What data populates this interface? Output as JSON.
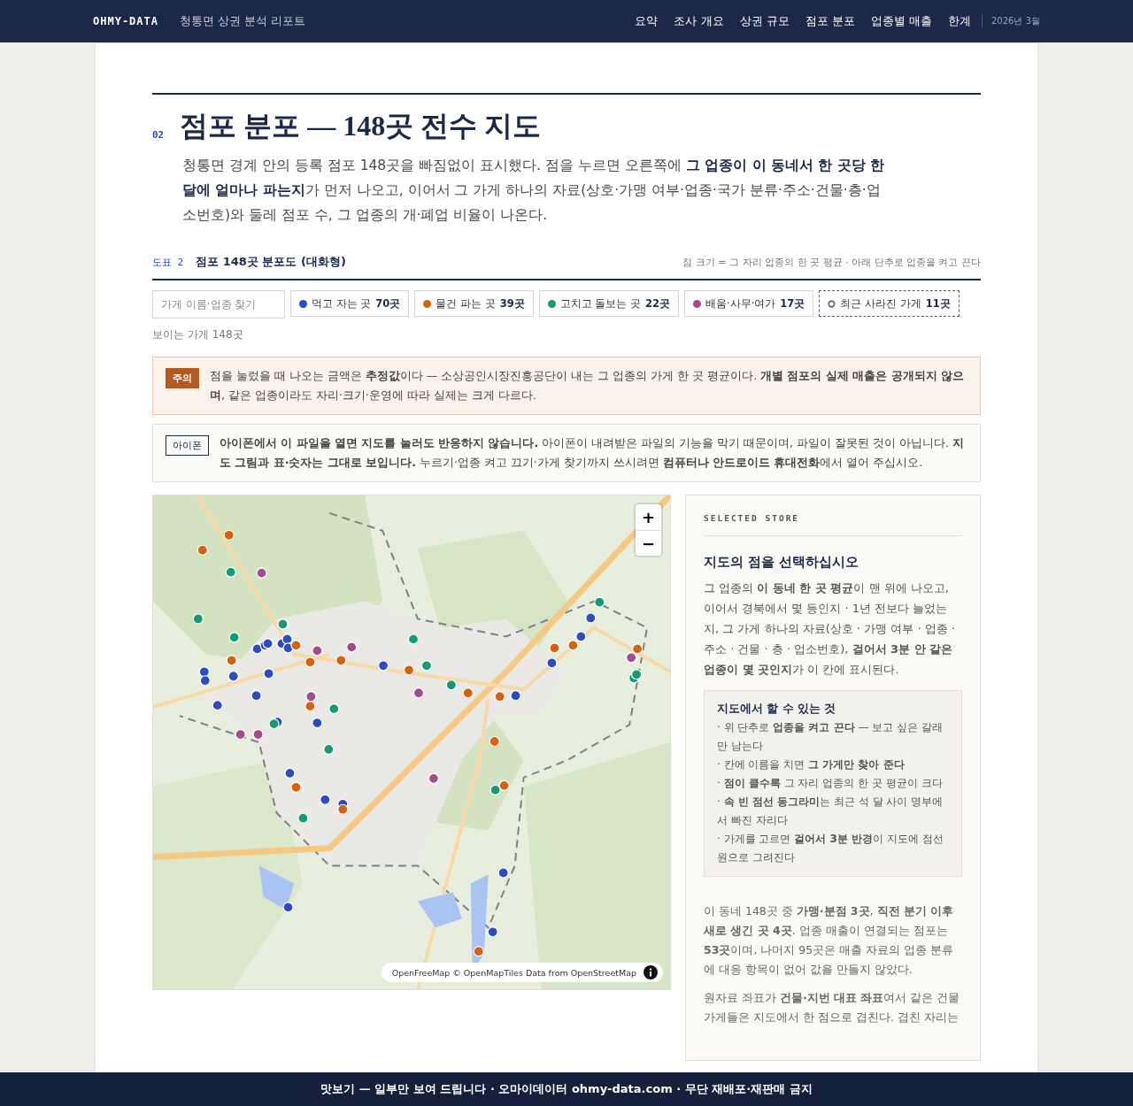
{
  "nav": {
    "brand": "OHMY-DATA",
    "subtitle": "청통면 상권 분석 리포트",
    "links": [
      "요약",
      "조사 개요",
      "상권 규모",
      "점포 분포",
      "업종별 매출",
      "한계"
    ],
    "date": "2026년 3월"
  },
  "section": {
    "number": "02",
    "title": "점포 분포 — 148곳 전수 지도",
    "intro": "청통면 경계 안의 등록 점포 148곳을 빠짐없이 표시했다. 점을 누르면 오른쪽에 **그 업종이 이 동네서 한 곳당 한 달에 얼마나 파는지**가 먼저 나오고, 이어서 그 가게 하나의 자료(상호·가맹 여부·업종·국가 분류·주소·건물·층·업소번호)와 둘레 점포 수, 그 업종의 개·폐업 비율이 나온다."
  },
  "figure": {
    "label": "도표 2",
    "title": "점포 148곳 분포도 (대화형)",
    "note": "점 크기 = 그 자리 업종의 한 곳 평균 · 아래 단추로 업종을 켜고 끈다"
  },
  "search": {
    "placeholder": "가게 이름·업종 찾기"
  },
  "filters": [
    {
      "kind": "dot",
      "color": "#2b4cc2",
      "label": "먹고 자는 곳",
      "count": "70곳"
    },
    {
      "kind": "dot",
      "color": "#d4620f",
      "label": "물건 파는 곳",
      "count": "39곳"
    },
    {
      "kind": "dot",
      "color": "#149a78",
      "label": "고치고 돌보는 곳",
      "count": "22곳"
    },
    {
      "kind": "dot",
      "color": "#a54a8c",
      "label": "배움·사무·여가",
      "count": "17곳"
    },
    {
      "kind": "ring",
      "color": "#6b7080",
      "label": "최근 사라진 가게",
      "count": "11곳"
    }
  ],
  "visible_count": "보이는 가게 148곳",
  "notices": [
    {
      "kind": "caution",
      "badge": "주의",
      "text": "점을 눌렀을 때 나오는 금액은 **추정값**이다 — 소상공인시장진흥공단이 내는 그 업종의 가게 한 곳 평균이다. **개별 점포의 실제 매출은 공개되지 않으며**, 같은 업종이라도 자리·크기·운영에 따라 실제는 크게 다르다."
    },
    {
      "kind": "info",
      "badge": "아이폰",
      "text": "**아이폰에서 이 파일을 열면 지도를 눌러도 반응하지 않습니다.** 아이폰이 내려받은 파일의 기능을 막기 때문이며, 파일이 잘못된 것이 아닙니다. **지도 그림과 표·숫자는 그대로 보입니다.** 누르기·업종 켜고 끄기·가게 찾기까지 쓰시려면 **컴퓨터나 안드로이드 휴대전화**에서 열어 주십시오."
    }
  ],
  "map": {
    "zoom_in": "+",
    "zoom_out": "−",
    "attribution": "OpenFreeMap © OpenMapTiles Data from OpenStreetMap"
  },
  "sidebar": {
    "eyebrow": "SELECTED STORE",
    "heading": "지도의 점을 선택하십시오",
    "intro": "그 업종의 **이 동네 한 곳 평균**이 맨 위에 나오고, 이어서 경북에서 몇 등인지 · 1년 전보다 늘었는지, 그 가게 하나의 자료(상호 · 가맹 여부 · 업종 · 주소 · 건물 · 층 · 업소번호), **걸어서 3분 안 같은 업종이 몇 곳인지**가 이 칸에 표시된다.",
    "tips": {
      "title": "지도에서 할 수 있는 것",
      "items": [
        "· 위 단추로 **업종을 켜고 끈다** — 보고 싶은 갈래만 남는다",
        "· 칸에 이름을 치면 **그 가게만 찾아 준다**",
        "· **점이 클수록** 그 자리 업종의 한 곳 평균이 크다",
        "· **속 빈 점선 동그라미**는 최근 석 달 사이 명부에서 빠진 자리다",
        "· 가게를 고르면 **걸어서 3분 반경**이 지도에 점선 원으로 그려진다"
      ]
    },
    "notes": [
      "이 동네 148곳 중 **가맹·분점 3곳**, **직전 분기 이후 새로 생긴 곳 4곳**. 업종 매출이 연결되는 점포는 **53곳**이며, 나머지 95곳은 매출 자료의 업종 분류에 대응 항목이 없어 값을 만들지 않았다.",
      "원자료 좌표가 **건물·지번 대표 좌표**여서 같은 건물 가게들은 지도에서 한 점으로 겹친다. 겹친 자리는"
    ]
  },
  "footer": "맛보기 — 일부만 보여 드립니다 · 오마이데이터 ohmy-data.com · 무단 재배포·재판매 금지"
}
